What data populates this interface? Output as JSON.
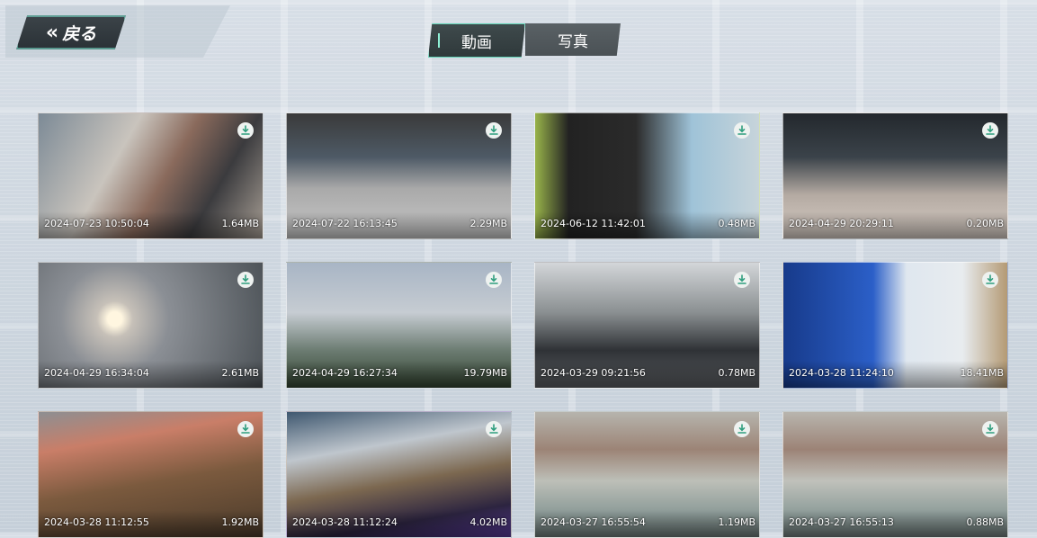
{
  "header": {
    "back_label": "戻る",
    "tabs": [
      {
        "label": "動画",
        "active": true
      },
      {
        "label": "写真",
        "active": false
      }
    ]
  },
  "colors": {
    "accent": "#5fd3b6",
    "tab_active_bg": "#333d3f",
    "tab_inactive_bg": "#4f5659"
  },
  "items": [
    {
      "date": "2024-07-23 10:50:04",
      "size": "1.64MB"
    },
    {
      "date": "2024-07-22 16:13:45",
      "size": "2.29MB"
    },
    {
      "date": "2024-06-12 11:42:01",
      "size": "0.48MB"
    },
    {
      "date": "2024-04-29 20:29:11",
      "size": "0.20MB"
    },
    {
      "date": "2024-04-29 16:34:04",
      "size": "2.61MB"
    },
    {
      "date": "2024-04-29 16:27:34",
      "size": "19.79MB"
    },
    {
      "date": "2024-03-29 09:21:56",
      "size": "0.78MB"
    },
    {
      "date": "2024-03-28 11:24:10",
      "size": "18.41MB"
    },
    {
      "date": "2024-03-28 11:12:55",
      "size": "1.92MB"
    },
    {
      "date": "2024-03-28 11:12:24",
      "size": "4.02MB"
    },
    {
      "date": "2024-03-27 16:55:54",
      "size": "1.19MB"
    },
    {
      "date": "2024-03-27 16:55:13",
      "size": "0.88MB"
    }
  ]
}
